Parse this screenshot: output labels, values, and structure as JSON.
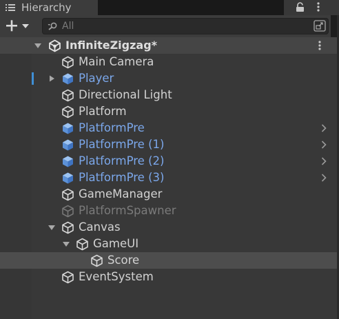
{
  "window": {
    "tab_title": "Hierarchy",
    "tab_icon": "list-icon",
    "lock_icon": "lock-icon",
    "menu_icon": "kebab-menu-icon"
  },
  "toolbar": {
    "add_icon": "plus-dropdown-icon",
    "search_placeholder": "All",
    "search_icon": "search-icon",
    "filter_icon": "scene-filter-icon"
  },
  "colors": {
    "prefab_text": "#7ba7ea",
    "normal_text": "#d2d2d2",
    "disabled_text": "#7a7a7a",
    "selection_bg": "#4d4d4d",
    "accent_marker": "#3f8fd6"
  },
  "scene": {
    "name": "InfiniteZigzag*",
    "icon": "unity-scene-icon",
    "expanded": true
  },
  "items": [
    {
      "label": "Main Camera",
      "depth": 1,
      "kind": "gameobject",
      "icon": "cube-outline-icon"
    },
    {
      "label": "Player",
      "depth": 1,
      "kind": "prefab",
      "icon": "prefab-cube-icon",
      "collapsed": true,
      "marked": true
    },
    {
      "label": "Directional Light",
      "depth": 1,
      "kind": "gameobject",
      "icon": "cube-outline-icon"
    },
    {
      "label": "Platform",
      "depth": 1,
      "kind": "gameobject",
      "icon": "cube-outline-icon"
    },
    {
      "label": "PlatformPre",
      "depth": 1,
      "kind": "prefab",
      "icon": "prefab-cube-icon",
      "chevron": true
    },
    {
      "label": "PlatformPre (1)",
      "depth": 1,
      "kind": "prefab",
      "icon": "prefab-cube-icon",
      "chevron": true
    },
    {
      "label": "PlatformPre (2)",
      "depth": 1,
      "kind": "prefab",
      "icon": "prefab-cube-icon",
      "chevron": true
    },
    {
      "label": "PlatformPre (3)",
      "depth": 1,
      "kind": "prefab",
      "icon": "prefab-cube-icon",
      "chevron": true
    },
    {
      "label": "GameManager",
      "depth": 1,
      "kind": "gameobject",
      "icon": "cube-outline-icon"
    },
    {
      "label": "PlatformSpawner",
      "depth": 1,
      "kind": "disabled",
      "icon": "cube-outline-icon"
    },
    {
      "label": "Canvas",
      "depth": 1,
      "kind": "gameobject",
      "icon": "cube-outline-icon",
      "expanded": true
    },
    {
      "label": "GameUI",
      "depth": 2,
      "kind": "gameobject",
      "icon": "cube-outline-icon",
      "expanded": true
    },
    {
      "label": "Score",
      "depth": 3,
      "kind": "gameobject",
      "icon": "cube-outline-icon",
      "selected": true
    },
    {
      "label": "EventSystem",
      "depth": 1,
      "kind": "gameobject",
      "icon": "cube-outline-icon"
    }
  ]
}
